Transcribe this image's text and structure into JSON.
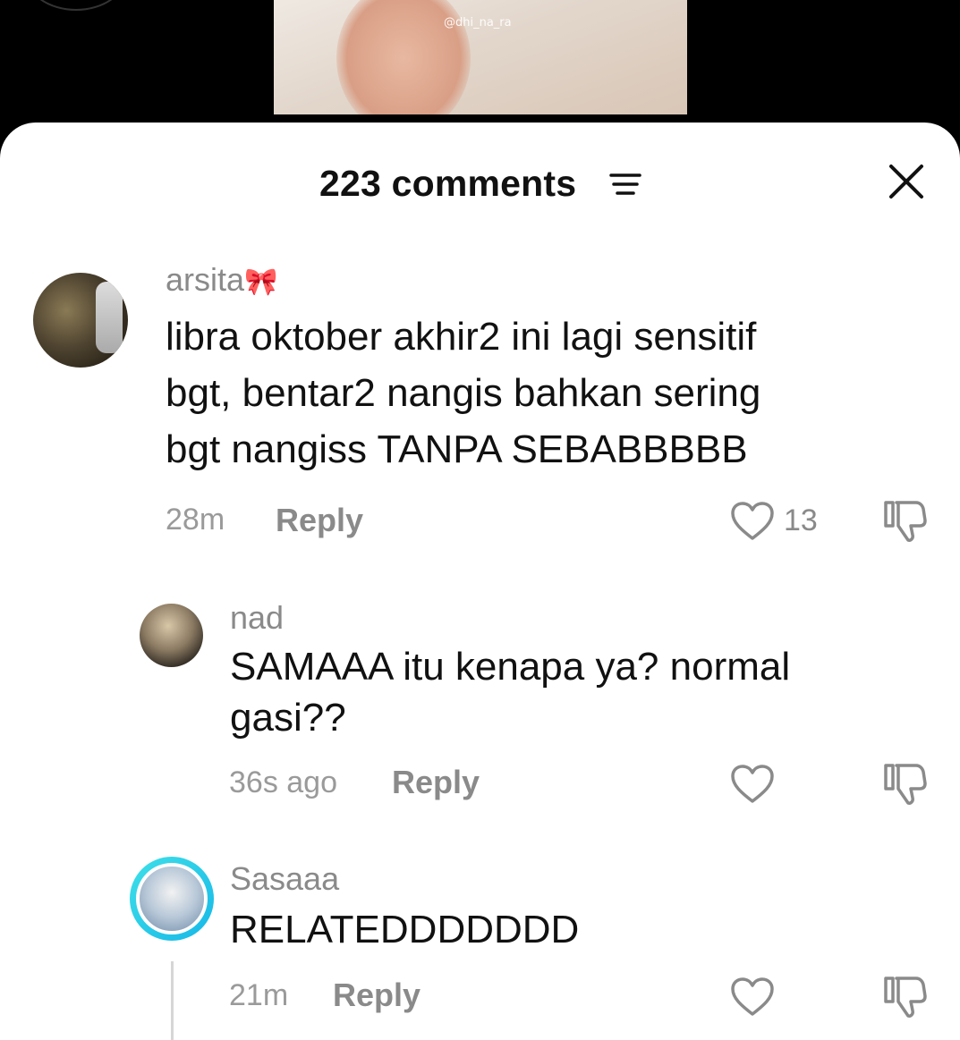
{
  "video": {
    "watermark": "@dhi_na_ra"
  },
  "header": {
    "count_label": "223 comments"
  },
  "comments": [
    {
      "username": "arsita",
      "emoji": "🎀",
      "lines": [
        "libra oktober akhir2 ini lagi sensitif",
        "bgt, bentar2 nangis bahkan sering",
        "bgt nangiss TANPA SEBABBBBB"
      ],
      "time": "28m",
      "reply_label": "Reply",
      "likes": "13"
    },
    {
      "username": "nad",
      "lines": [
        "SAMAAA itu kenapa ya? normal",
        "gasi??"
      ],
      "time": "36s ago",
      "reply_label": "Reply"
    },
    {
      "username": "Sasaaa",
      "lines": [
        "RELATEDDDDDDD"
      ],
      "time": "21m",
      "reply_label": "Reply"
    }
  ],
  "icons": {
    "filter": "filter-icon",
    "close": "close-icon",
    "like": "heart-icon",
    "dislike": "thumbs-down-icon"
  },
  "colors": {
    "story_ring": "#16b8e8",
    "muted_text": "#8a8a8a"
  }
}
